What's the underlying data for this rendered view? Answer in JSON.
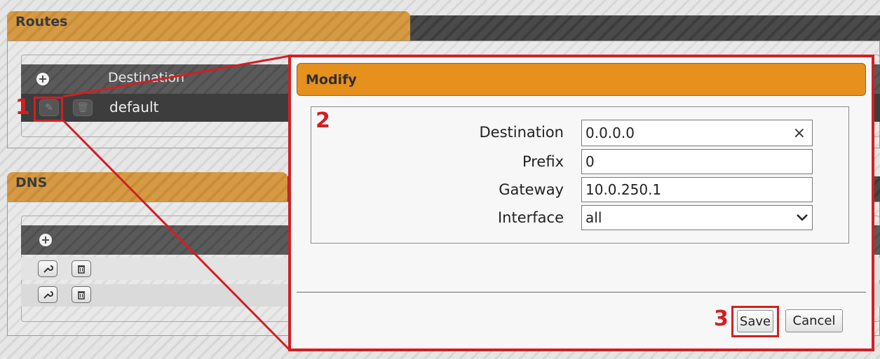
{
  "routes": {
    "title": "Routes",
    "header_icon": "plus-circle-icon",
    "column_destination": "Destination",
    "row_value": "default"
  },
  "dns": {
    "title": "DNS",
    "header_icon": "plus-circle-icon",
    "row_icons": [
      "wrench-icon",
      "trash-icon"
    ]
  },
  "callouts": [
    "1",
    "2",
    "3"
  ],
  "modal": {
    "title": "Modify",
    "fields": {
      "destination": {
        "label": "Destination",
        "value": "0.0.0.0",
        "clear_glyph": "×"
      },
      "prefix": {
        "label": "Prefix",
        "value": "0"
      },
      "gateway": {
        "label": "Gateway",
        "value": "10.0.250.1"
      },
      "interface": {
        "label": "Interface",
        "value": "all"
      }
    },
    "buttons": {
      "save": "Save",
      "cancel": "Cancel"
    }
  },
  "colors": {
    "callout_red": "#d21f24",
    "modal_header_orange": "#e6901e",
    "section_tab_orange": "#d59a43"
  }
}
